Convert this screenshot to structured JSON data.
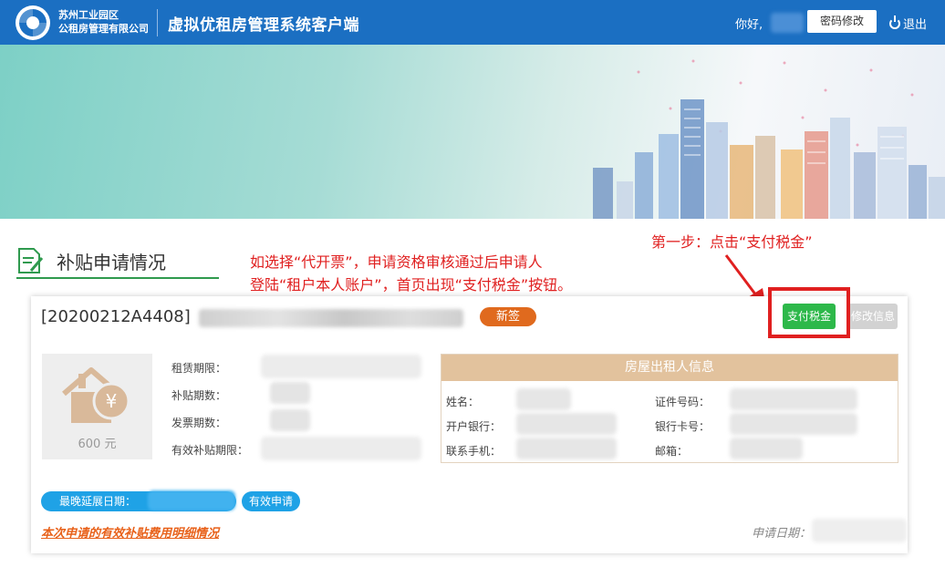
{
  "header": {
    "org_line1": "苏州工业园区",
    "org_line2": "公租房管理有限公司",
    "system_title": "虚拟优租房管理系统客户端",
    "greeting": "你好,",
    "password_button": "密码修改",
    "logout_label": "退出"
  },
  "section": {
    "title": "补贴申请情况"
  },
  "annotations": {
    "instruction_line1": "如选择“代开票”，申请资格审核通过后申请人",
    "instruction_line2": "登陆“租户本人账户”，首页出现“支付税金”按钮。",
    "step1": "第一步：点击“支付税金”"
  },
  "card": {
    "application_id": "[20200212A4408]",
    "badge": "新签",
    "pay_tax_button": "支付税金",
    "edit_info_button": "修改信息",
    "subsidy_amount": "600 元",
    "fields": {
      "lease_period": "租赁期限：",
      "subsidy_periods": "补贴期数：",
      "invoice_periods": "发票期数：",
      "valid_subsidy_period": "有效补贴期限："
    },
    "owner": {
      "header": "房屋出租人信息",
      "name": "姓名：",
      "bank": "开户银行：",
      "phone": "联系手机：",
      "id_number": "证件号码：",
      "card_number": "银行卡号：",
      "email": "邮箱："
    },
    "deadline_label": "最晚延展日期：",
    "valid_apply_button": "有效申请",
    "detail_link": "本次申请的有效补贴费用明细情况",
    "apply_date_label": "申请日期："
  },
  "colors": {
    "header_bg": "#1b6fc2",
    "annotation_red": "#e02020",
    "pay_green": "#2db84a",
    "badge_orange": "#e06a1e",
    "owner_header": "#e2c29d",
    "deadline_blue": "#1fa2e6"
  }
}
